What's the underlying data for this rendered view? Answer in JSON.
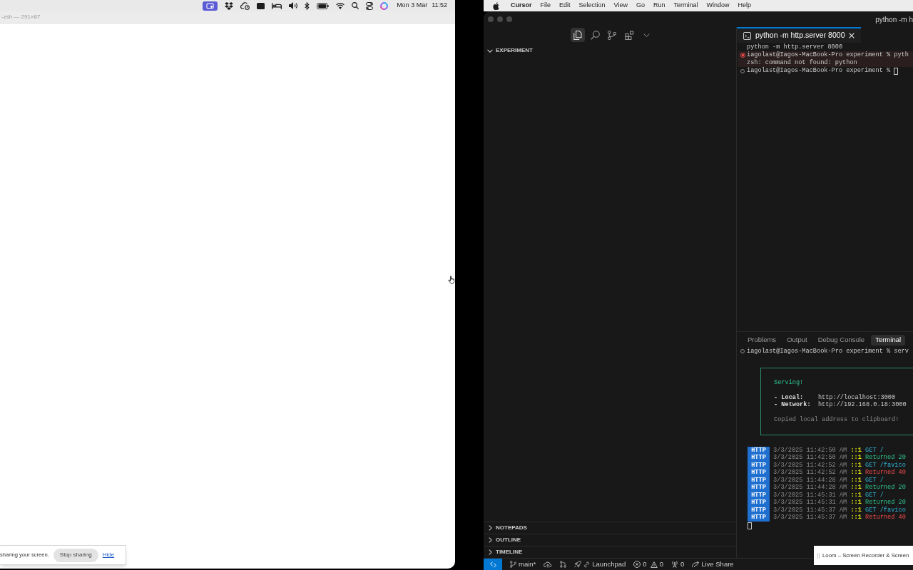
{
  "desktop_menu_bar": {
    "date": "Mon 3 Mar",
    "time": "11:52"
  },
  "terminal_window": {
    "title": "-zsh — 291×87"
  },
  "screen_share_notice": {
    "message": "sharing your screen.",
    "stop_button": "Stop sharing",
    "hide_link": "Hide"
  },
  "app_menu_bar": {
    "app_name": "Cursor",
    "items": [
      "File",
      "Edit",
      "Selection",
      "View",
      "Go",
      "Run",
      "Terminal",
      "Window",
      "Help"
    ]
  },
  "editor_window": {
    "title": "python -m h",
    "activity_tabs": [
      {
        "kind": "explorer",
        "selected": true
      },
      {
        "kind": "search",
        "selected": false
      },
      {
        "kind": "source-control",
        "selected": false
      },
      {
        "kind": "extensions",
        "selected": false
      },
      {
        "kind": "more",
        "selected": false
      }
    ],
    "sidebar_sections": [
      {
        "title": "EXPERIMENT",
        "expanded": true
      },
      {
        "title": "NOTEPADS",
        "expanded": false
      },
      {
        "title": "OUTLINE",
        "expanded": false
      },
      {
        "title": "TIMELINE",
        "expanded": false
      }
    ],
    "editor_tabs": [
      {
        "label": "python -m http.server 8000",
        "selected": true
      }
    ],
    "editor_terminal": {
      "lines": [
        {
          "text": "python -m http.server 8000",
          "highlighted": false
        },
        {
          "failed": true,
          "text": "iagolast@Iagos-MacBook-Pro experiment % pyth",
          "highlighted": true
        },
        {
          "text": "zsh: command not found: python",
          "highlighted": true
        },
        {
          "failed": false,
          "text": "iagolast@Iagos-MacBook-Pro experiment %",
          "cursor": true,
          "highlighted": false
        }
      ]
    },
    "panel": {
      "tabs": [
        {
          "label": "Problems",
          "selected": false
        },
        {
          "label": "Output",
          "selected": false
        },
        {
          "label": "Debug Console",
          "selected": false
        },
        {
          "label": "Terminal",
          "selected": true
        }
      ],
      "terminal": {
        "prompt": {
          "failed": false,
          "text": "iagolast@Iagos-MacBook-Pro experiment % serv"
        },
        "serve_box": {
          "heading": "Serving!",
          "rows": [
            {
              "label": "- Local:",
              "value": "http://localhost:3000"
            },
            {
              "label": "- Network:",
              "value": "http://192.168.0.18:3000"
            }
          ],
          "note": "Copied local address to clipboard!"
        },
        "log": [
          {
            "tag": "HTTP",
            "time": "3/3/2025 11:42:50 AM",
            "address": "::1",
            "kind": "request",
            "message": "GET /"
          },
          {
            "tag": "HTTP",
            "time": "3/3/2025 11:42:50 AM",
            "address": "::1",
            "kind": "success",
            "message": "Returned 20"
          },
          {
            "tag": "HTTP",
            "time": "3/3/2025 11:42:52 AM",
            "address": "::1",
            "kind": "request",
            "message": "GET /favico"
          },
          {
            "tag": "HTTP",
            "time": "3/3/2025 11:42:52 AM",
            "address": "::1",
            "kind": "error",
            "message": "Returned 40"
          },
          {
            "tag": "HTTP",
            "time": "3/3/2025 11:44:28 AM",
            "address": "::1",
            "kind": "request",
            "message": "GET /"
          },
          {
            "tag": "HTTP",
            "time": "3/3/2025 11:44:28 AM",
            "address": "::1",
            "kind": "success",
            "message": "Returned 20"
          },
          {
            "tag": "HTTP",
            "time": "3/3/2025 11:45:31 AM",
            "address": "::1",
            "kind": "request",
            "message": "GET /"
          },
          {
            "tag": "HTTP",
            "time": "3/3/2025 11:45:31 AM",
            "address": "::1",
            "kind": "success",
            "message": "Returned 20"
          },
          {
            "tag": "HTTP",
            "time": "3/3/2025 11:45:37 AM",
            "address": "::1",
            "kind": "request",
            "message": "GET /favico"
          },
          {
            "tag": "HTTP",
            "time": "3/3/2025 11:45:37 AM",
            "address": "::1",
            "kind": "error",
            "message": "Returned 40"
          }
        ],
        "cursor": true
      }
    },
    "status_bar": {
      "items": [
        {
          "kind": "remote"
        },
        {
          "kind": "branch",
          "label": "main*"
        },
        {
          "kind": "sync"
        },
        {
          "kind": "graph"
        },
        {
          "kind": "launchpad",
          "label": "Launchpad"
        },
        {
          "kind": "problems",
          "errors": "0",
          "warnings": "0"
        },
        {
          "kind": "ports",
          "label": "0"
        },
        {
          "kind": "live-share",
          "label": "Live Share"
        }
      ]
    }
  },
  "loom_popup": {
    "label": "Loom – Screen Recorder & Screen"
  }
}
